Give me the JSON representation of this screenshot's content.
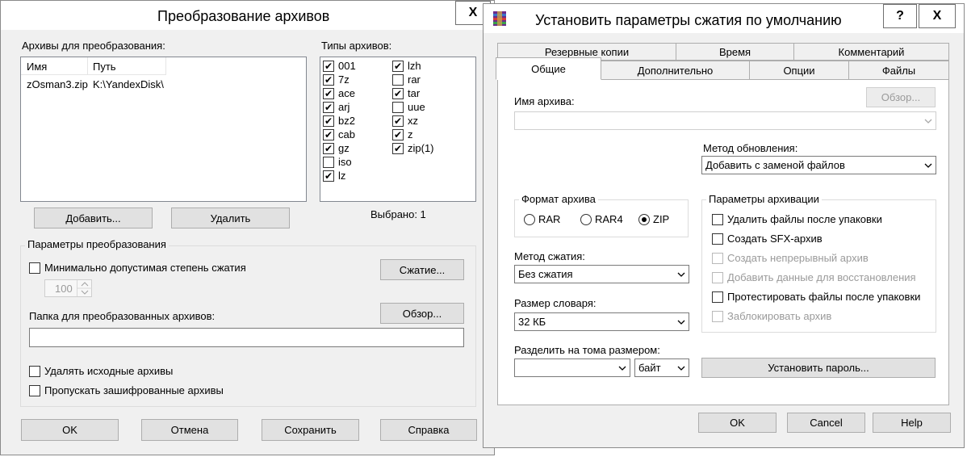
{
  "left_dialog": {
    "title": "Преобразование архивов",
    "close_glyph": "X",
    "archives_label": "Архивы для преобразования:",
    "columns": [
      "Имя",
      "Путь"
    ],
    "rows": [
      [
        "zOsman3.zip",
        "K:\\YandexDisk\\"
      ]
    ],
    "types_label": "Типы архивов:",
    "types_col1": [
      {
        "label": "001",
        "checked": true
      },
      {
        "label": "7z",
        "checked": true
      },
      {
        "label": "ace",
        "checked": true
      },
      {
        "label": "arj",
        "checked": true
      },
      {
        "label": "bz2",
        "checked": true
      },
      {
        "label": "cab",
        "checked": true
      },
      {
        "label": "gz",
        "checked": true
      },
      {
        "label": "iso",
        "checked": false
      },
      {
        "label": "lz",
        "checked": true
      }
    ],
    "types_col2": [
      {
        "label": "lzh",
        "checked": true
      },
      {
        "label": "rar",
        "checked": false
      },
      {
        "label": "tar",
        "checked": true
      },
      {
        "label": "uue",
        "checked": false
      },
      {
        "label": "xz",
        "checked": true
      },
      {
        "label": "z",
        "checked": true
      },
      {
        "label": "zip(1)",
        "checked": true
      }
    ],
    "selected_text": "Выбрано: 1",
    "add_button": "Добавить...",
    "delete_button": "Удалить",
    "params_group": "Параметры преобразования",
    "min_ratio_label": "Минимально допустимая степень сжатия",
    "min_ratio_value": "100",
    "compression_button": "Сжатие...",
    "folder_label": "Папка для преобразованных архивов:",
    "browse_button": "Обзор...",
    "folder_value": "",
    "delete_source_label": "Удалять исходные архивы",
    "skip_encrypted_label": "Пропускать зашифрованные архивы",
    "ok_button": "OK",
    "cancel_button": "Отмена",
    "save_button": "Сохранить",
    "help_button": "Справка"
  },
  "right_dialog": {
    "title": "Установить параметры сжатия по умолчанию",
    "help_glyph": "?",
    "close_glyph": "X",
    "tabs_row1": [
      "Резервные копии",
      "Время",
      "Комментарий"
    ],
    "tabs_row2": [
      "Общие",
      "Дополнительно",
      "Опции",
      "Файлы"
    ],
    "archive_name_label": "Имя архива:",
    "archive_name_value": "",
    "browse_button": "Обзор...",
    "update_method_label": "Метод обновления:",
    "update_method_value": "Добавить с заменой файлов",
    "format_group": "Формат архива",
    "formats": [
      {
        "label": "RAR",
        "selected": false
      },
      {
        "label": "RAR4",
        "selected": false
      },
      {
        "label": "ZIP",
        "selected": true
      }
    ],
    "compression_method_label": "Метод сжатия:",
    "compression_method_value": "Без сжатия",
    "dict_size_label": "Размер словаря:",
    "dict_size_value": "32 КБ",
    "split_label": "Разделить на тома размером:",
    "split_value": "",
    "split_unit": "байт",
    "archive_params_group": "Параметры архивации",
    "options": [
      {
        "label": "Удалить файлы после упаковки",
        "checked": false,
        "disabled": false
      },
      {
        "label": "Создать SFX-архив",
        "checked": false,
        "disabled": false
      },
      {
        "label": "Создать непрерывный архив",
        "checked": false,
        "disabled": true
      },
      {
        "label": "Добавить данные для восстановления",
        "checked": false,
        "disabled": true
      },
      {
        "label": "Протестировать файлы после упаковки",
        "checked": false,
        "disabled": false
      },
      {
        "label": "Заблокировать архив",
        "checked": false,
        "disabled": true
      }
    ],
    "password_button": "Установить пароль...",
    "ok_button": "OK",
    "cancel_button": "Cancel",
    "help_button": "Help"
  },
  "colors": {
    "window_bg": "#f0f0f0",
    "titlebar_bg": "#ffffff",
    "border": "#8a8a8a"
  },
  "icons": [
    "close-icon",
    "help-icon",
    "winrar-icon",
    "checkmark-icon",
    "chevron-down-icon",
    "spinner-icon"
  ]
}
